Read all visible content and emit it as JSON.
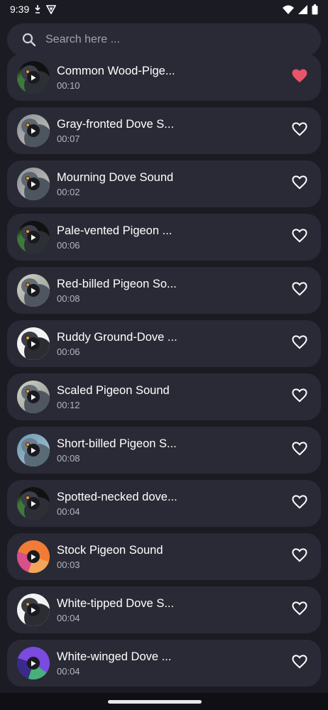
{
  "status_bar": {
    "time": "9:39"
  },
  "search": {
    "placeholder": "Search here ..."
  },
  "colors": {
    "background": "#1b1b23",
    "card": "#2a2a36",
    "favorite_active": "#e8546a",
    "favorite_outline": "#ffffff"
  },
  "sounds": [
    {
      "title": "Common Wood-Pige...",
      "duration": "00:10",
      "favorite": true,
      "thumb": "dark-pigeon-green"
    },
    {
      "title": "Gray-fronted Dove S...",
      "duration": "00:07",
      "favorite": false,
      "thumb": "gray-pigeon"
    },
    {
      "title": "Mourning Dove Sound",
      "duration": "00:02",
      "favorite": false,
      "thumb": "gray-pigeon"
    },
    {
      "title": "Pale-vented Pigeon ...",
      "duration": "00:06",
      "favorite": false,
      "thumb": "dark-pigeon-green"
    },
    {
      "title": "Red-billed Pigeon So...",
      "duration": "00:08",
      "favorite": false,
      "thumb": "gray-pigeon-light"
    },
    {
      "title": "Ruddy Ground-Dove ...",
      "duration": "00:06",
      "favorite": false,
      "thumb": "pigeon-white"
    },
    {
      "title": "Scaled Pigeon Sound",
      "duration": "00:12",
      "favorite": false,
      "thumb": "gray-pigeon-light"
    },
    {
      "title": "Short-billed Pigeon S...",
      "duration": "00:08",
      "favorite": false,
      "thumb": "blue-pigeon"
    },
    {
      "title": "Spotted-necked dove...",
      "duration": "00:04",
      "favorite": false,
      "thumb": "dark-pigeon-green"
    },
    {
      "title": "Stock Pigeon Sound",
      "duration": "00:03",
      "favorite": false,
      "thumb": "orange-swirl"
    },
    {
      "title": "White-tipped Dove S...",
      "duration": "00:04",
      "favorite": false,
      "thumb": "pigeon-white"
    },
    {
      "title": "White-winged Dove ...",
      "duration": "00:04",
      "favorite": false,
      "thumb": "purple-swirl"
    }
  ]
}
